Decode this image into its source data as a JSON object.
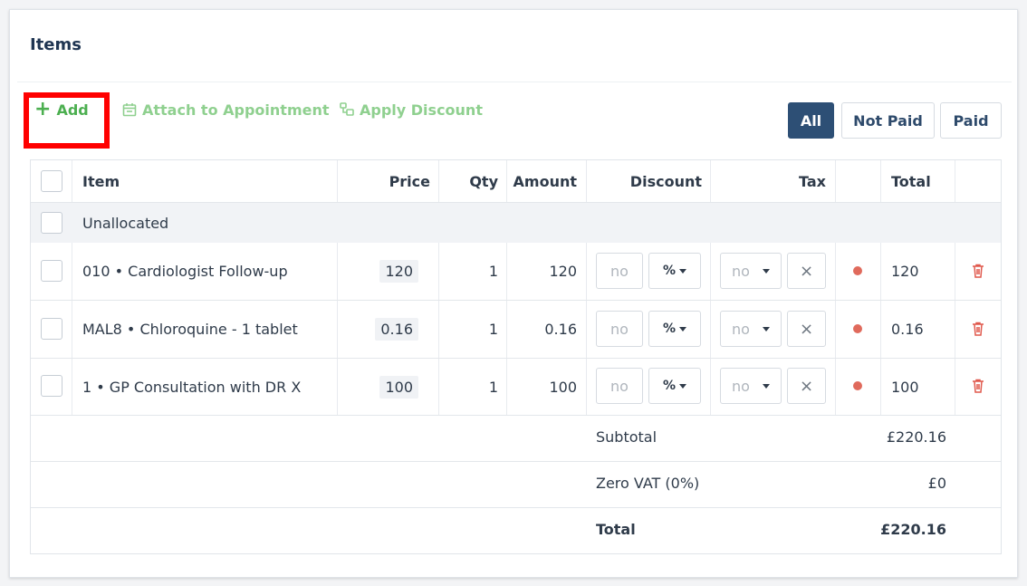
{
  "panel": {
    "title": "Items"
  },
  "toolbar": {
    "add_label": "Add",
    "attach_label": "Attach to Appointment",
    "discount_label": "Apply Discount",
    "filters": [
      "All",
      "Not Paid",
      "Paid"
    ]
  },
  "table": {
    "headers": {
      "item": "Item",
      "price": "Price",
      "qty": "Qty",
      "amount": "Amount",
      "discount": "Discount",
      "tax": "Tax",
      "total": "Total"
    },
    "group_label": "Unallocated",
    "rows": [
      {
        "item": "010 • Cardiologist Follow-up",
        "price": "120",
        "qty": "1",
        "amount": "120",
        "discount_placeholder": "no",
        "discount_type": "%",
        "tax_placeholder": "no",
        "total": "120"
      },
      {
        "item": "MAL8 • Chloroquine - 1 tablet",
        "price": "0.16",
        "qty": "1",
        "amount": "0.16",
        "discount_placeholder": "no",
        "discount_type": "%",
        "tax_placeholder": "no",
        "total": "0.16"
      },
      {
        "item": "1 • GP Consultation with DR X",
        "price": "100",
        "qty": "1",
        "amount": "100",
        "discount_placeholder": "no",
        "discount_type": "%",
        "tax_placeholder": "no",
        "total": "100"
      }
    ],
    "summary": {
      "subtotal_label": "Subtotal",
      "subtotal_value": "£220.16",
      "vat_label": "Zero VAT (0%)",
      "vat_value": "£0",
      "total_label": "Total",
      "total_value": "£220.16"
    }
  },
  "colors": {
    "accent_green": "#4caf50",
    "active_filter": "#2d4f75",
    "status_dot": "#e06a5c",
    "delete_icon": "#e0584c",
    "highlight": "#ff0000"
  }
}
